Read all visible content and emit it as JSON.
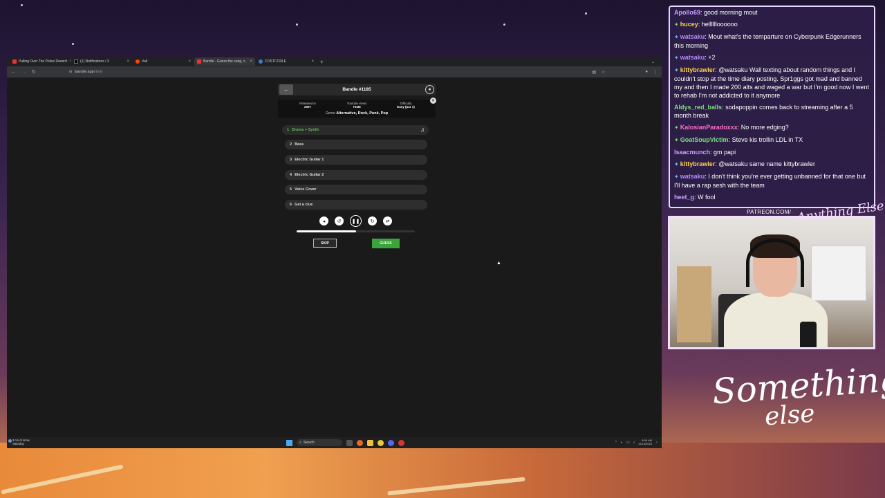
{
  "browser": {
    "tabs": [
      {
        "title": "Pulling Over The Police Doesn't",
        "color": "#e33"
      },
      {
        "title": "(1) Notifications / X",
        "color": "#000"
      },
      {
        "title": "r/all",
        "color": "#ff4500"
      },
      {
        "title": "Bandle - Guess the song, o",
        "color": "#e33"
      },
      {
        "title": "COSTCODLE",
        "color": "#3a7bd5"
      }
    ],
    "new_tab": "+",
    "url_host": "bandle.app",
    "url_path": "/daily"
  },
  "bandle": {
    "title": "Bandle #1185",
    "released_label": "Released in",
    "released_value": "2007",
    "views_label": "Youtube views",
    "views_value": "704M",
    "difficulty_label": "Difficulty",
    "difficulty_value": "Easy (par 1)",
    "genre_label": "Genre",
    "genre_value": "Alternative, Rock, Punk, Pop",
    "tracks": [
      {
        "num": "1",
        "label": "Drums + Synth"
      },
      {
        "num": "2",
        "label": "Bass"
      },
      {
        "num": "3",
        "label": "Electric Guitar 1"
      },
      {
        "num": "4",
        "label": "Electric Guitar 2"
      },
      {
        "num": "5",
        "label": "Voice Cover"
      },
      {
        "num": "6",
        "label": "Get a clue"
      }
    ],
    "progress_fraction": 0.5,
    "skip_label": "SKIP",
    "guess_label": "GUESS"
  },
  "taskbar": {
    "weather_line1": "3 cm of snow",
    "weather_line2": "Saturday",
    "search_placeholder": "Search",
    "time": "8:06 AM",
    "date": "11/16/2025"
  },
  "chat": {
    "messages": [
      {
        "user": "Apollo69",
        "user_color": "#c8a0ff",
        "badge": "",
        "text": "good morning mout"
      },
      {
        "user": "hucey",
        "user_color": "#ffd24a",
        "badge": "green",
        "text": "helllllloooooo"
      },
      {
        "user": "watsaku",
        "user_color": "#b58cff",
        "badge": "blue",
        "text": "Mout what's the temparture on Cyberpunk Edgerunners this morning"
      },
      {
        "user": "watsaku",
        "user_color": "#b58cff",
        "badge": "blue",
        "text": "+2"
      },
      {
        "user": "kittybrawler",
        "user_color": "#ffd24a",
        "badge": "blue",
        "text": "@watsaku Wall texting about random things and I couldn't stop at the time diary posting. Spr1ggs got mad and banned my and then I made 200 alts and waged a war but I'm good now I went to rehab I'm not addicted to it anymore"
      },
      {
        "user": "Aldys_red_balls",
        "user_color": "#7ce07c",
        "badge": "",
        "text": "sodapoppin comes back to streaming after a 5 month break"
      },
      {
        "user": "KalosianParadoxxx",
        "user_color": "#ff6ec7",
        "badge": "green",
        "text": "No more edging?"
      },
      {
        "user": "GoatSoupVictim",
        "user_color": "#7ce07c",
        "badge": "green",
        "text": "Steve kis trollin LDL in TX"
      },
      {
        "user": "Isaacmunch",
        "user_color": "#c8a0ff",
        "badge": "",
        "text": "gm papi"
      },
      {
        "user": "kittybrawler",
        "user_color": "#ffd24a",
        "badge": "blue",
        "text": "@watsaku same name kittybrawler"
      },
      {
        "user": "watsaku",
        "user_color": "#b58cff",
        "badge": "blue",
        "text": "I don't think you're ever getting unbanned for that one but I'll have a rap sesh with the team"
      },
      {
        "user": "heet_g",
        "user_color": "#c8a0ff",
        "badge": "",
        "text": "W fool"
      }
    ]
  },
  "overlay": {
    "patreon": "PATREON.COM/",
    "logo_small": "Anything Else",
    "logo_big_line1": "Something",
    "logo_big_line2": "else"
  }
}
